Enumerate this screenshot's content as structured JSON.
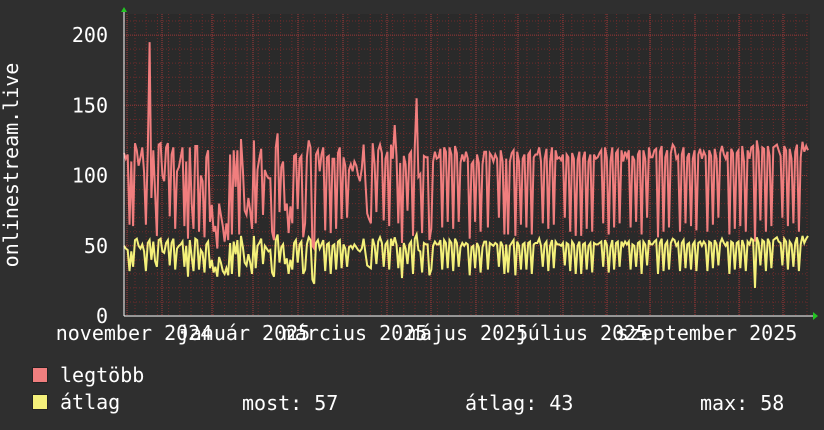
{
  "chart_data": {
    "type": "line",
    "ylabel": "onlinestream.live",
    "ylim": [
      0,
      215
    ],
    "yticks": [
      0,
      50,
      100,
      150,
      200
    ],
    "x_tick_labels": [
      "november 2024",
      "január 2025",
      "március 2025",
      "május 2025",
      "július 2025",
      "szeptember 2025"
    ],
    "colors": {
      "background": "#2f2f2f",
      "plot": "#2a2a2a",
      "grid": "#6e2a2a",
      "max": "#f07e7e",
      "avg": "#f4f07a"
    },
    "series": [
      {
        "name": "legtöbb",
        "color": "#f07e7e",
        "values": [
          116,
          112,
          115,
          65,
          110,
          64,
          123,
          118,
          107,
          113,
          120,
          102,
          65,
          118,
          195,
          84,
          118,
          88,
          57,
          122,
          123,
          100,
          96,
          120,
          123,
          71,
          115,
          120,
          62,
          103,
          106,
          113,
          120,
          64,
          110,
          55,
          120,
          80,
          62,
          121,
          121,
          60,
          100,
          96,
          56,
          113,
          118,
          67,
          79,
          60,
          64,
          48,
          80,
          72,
          64,
          53,
          66,
          54,
          115,
          58,
          118,
          92,
          118,
          58,
          126,
          104,
          75,
          72,
          84,
          75,
          62,
          125,
          66,
          104,
          112,
          119,
          72,
          104,
          100,
          98,
          98,
          60,
          54,
          120,
          130,
          74,
          106,
          110,
          75,
          80,
          59,
          78,
          66,
          114,
          115,
          76,
          112,
          114,
          56,
          66,
          113,
          125,
          120,
          50,
          48,
          115,
          118,
          103,
          115,
          120,
          61,
          113,
          114,
          59,
          112,
          112,
          62,
          116,
          120,
          69,
          113,
          107,
          70,
          104,
          108,
          103,
          110,
          107,
          100,
          96,
          105,
          122,
          96,
          73,
          69,
          66,
          123,
          108,
          74,
          118,
          122,
          116,
          68,
          112,
          117,
          64,
          122,
          112,
          136,
          114,
          66,
          109,
          52,
          114,
          108,
          75,
          115,
          117,
          57,
          121,
          155,
          99,
          101,
          59,
          114,
          113,
          113,
          54,
          62,
          110,
          117,
          112,
          113,
          119,
          63,
          120,
          117,
          67,
          120,
          115,
          62,
          121,
          116,
          67,
          109,
          115,
          110,
          117,
          112,
          55,
          108,
          110,
          67,
          115,
          109,
          60,
          108,
          117,
          117,
          63,
          116,
          114,
          110,
          115,
          112,
          70,
          118,
          110,
          58,
          112,
          58,
          110,
          116,
          118,
          57,
          117,
          110,
          65,
          112,
          115,
          63,
          115,
          117,
          58,
          113,
          115,
          115,
          120,
          110,
          66,
          112,
          119,
          62,
          110,
          120,
          65,
          118,
          112,
          113,
          111,
          115,
          70,
          115,
          113,
          60,
          116,
          112,
          57,
          111,
          117,
          57,
          112,
          117,
          62,
          110,
          115,
          60,
          115,
          112,
          113,
          116,
          118,
          66,
          120,
          113,
          58,
          110,
          120,
          63,
          116,
          118,
          66,
          118,
          110,
          117,
          113,
          118,
          63,
          114,
          111,
          67,
          115,
          118,
          58,
          118,
          112,
          70,
          120,
          113,
          113,
          118,
          119,
          56,
          117,
          121,
          60,
          113,
          118,
          63,
          116,
          122,
          120,
          112,
          114,
          60,
          115,
          120,
          66,
          113,
          116,
          64,
          112,
          118,
          61,
          115,
          119,
          112,
          117,
          114,
          60,
          118,
          114,
          65,
          119,
          112,
          70,
          116,
          121,
          115,
          112,
          117,
          58,
          119,
          116,
          62,
          116,
          118,
          64,
          121,
          110,
          60,
          118,
          112,
          120,
          121,
          53,
          125,
          117,
          68,
          120,
          119,
          60,
          121,
          114,
          64,
          120,
          121,
          122,
          118,
          114,
          70,
          121,
          118,
          64,
          119,
          112,
          66,
          117,
          122,
          60,
          113,
          124,
          117,
          121,
          118
        ]
      },
      {
        "name": "átlag",
        "color": "#f4f07a",
        "values": [
          50,
          48,
          47,
          32,
          46,
          35,
          54,
          55,
          50,
          48,
          51,
          46,
          32,
          52,
          54,
          40,
          53,
          39,
          35,
          54,
          55,
          46,
          45,
          52,
          54,
          36,
          52,
          55,
          33,
          48,
          50,
          51,
          53,
          35,
          50,
          28,
          54,
          42,
          32,
          55,
          54,
          33,
          47,
          45,
          31,
          51,
          53,
          34,
          40,
          31,
          35,
          28,
          42,
          38,
          32,
          30,
          34,
          29,
          52,
          30,
          53,
          44,
          54,
          28,
          57,
          49,
          38,
          36,
          44,
          38,
          30,
          57,
          34,
          50,
          52,
          55,
          37,
          50,
          48,
          46,
          47,
          31,
          28,
          54,
          58,
          38,
          49,
          51,
          37,
          41,
          30,
          40,
          33,
          52,
          54,
          38,
          51,
          53,
          30,
          33,
          51,
          56,
          54,
          26,
          23,
          52,
          54,
          48,
          51,
          54,
          32,
          51,
          52,
          30,
          50,
          51,
          33,
          53,
          54,
          34,
          51,
          48,
          35,
          49,
          50,
          48,
          51,
          49,
          47,
          46,
          48,
          55,
          45,
          36,
          35,
          34,
          55,
          50,
          37,
          53,
          56,
          52,
          35,
          51,
          53,
          33,
          55,
          50,
          56,
          51,
          34,
          49,
          27,
          52,
          48,
          37,
          51,
          53,
          30,
          55,
          58,
          47,
          46,
          31,
          52,
          51,
          51,
          29,
          33,
          50,
          53,
          51,
          51,
          54,
          33,
          54,
          52,
          34,
          54,
          52,
          32,
          55,
          52,
          35,
          49,
          52,
          50,
          52,
          51,
          29,
          49,
          50,
          34,
          52,
          49,
          31,
          49,
          53,
          53,
          33,
          52,
          51,
          50,
          52,
          51,
          35,
          53,
          50,
          30,
          51,
          31,
          50,
          52,
          54,
          29,
          53,
          50,
          33,
          51,
          52,
          33,
          52,
          53,
          30,
          51,
          52,
          52,
          55,
          50,
          35,
          51,
          53,
          32,
          50,
          54,
          34,
          53,
          51,
          51,
          50,
          52,
          36,
          52,
          51,
          32,
          53,
          51,
          30,
          50,
          53,
          30,
          51,
          52,
          33,
          50,
          52,
          31,
          52,
          51,
          51,
          52,
          53,
          35,
          54,
          51,
          31,
          49,
          54,
          33,
          52,
          53,
          35,
          53,
          50,
          53,
          51,
          53,
          33,
          51,
          50,
          35,
          52,
          53,
          30,
          53,
          51,
          36,
          54,
          51,
          51,
          53,
          54,
          30,
          52,
          55,
          32,
          51,
          53,
          33,
          52,
          55,
          54,
          50,
          52,
          32,
          52,
          54,
          34,
          51,
          52,
          33,
          51,
          53,
          32,
          52,
          53,
          50,
          53,
          51,
          32,
          53,
          52,
          34,
          54,
          51,
          36,
          52,
          55,
          52,
          50,
          53,
          30,
          53,
          52,
          33,
          52,
          53,
          34,
          54,
          50,
          32,
          53,
          51,
          55,
          54,
          20,
          56,
          52,
          36,
          54,
          53,
          32,
          55,
          52,
          34,
          54,
          55,
          56,
          53,
          52,
          36,
          55,
          53,
          33,
          53,
          51,
          35,
          52,
          56,
          32,
          51,
          57,
          52,
          55,
          57
        ]
      }
    ],
    "legend": [
      {
        "label": "legtöbb",
        "color": "#f07e7e"
      },
      {
        "label": "átlag",
        "color": "#f4f07a"
      }
    ],
    "stats": {
      "most_label": "most:",
      "most_value": "57",
      "atlag_label": "átlag:",
      "atlag_value": "43",
      "max_label": "max:",
      "max_value": "58"
    }
  }
}
